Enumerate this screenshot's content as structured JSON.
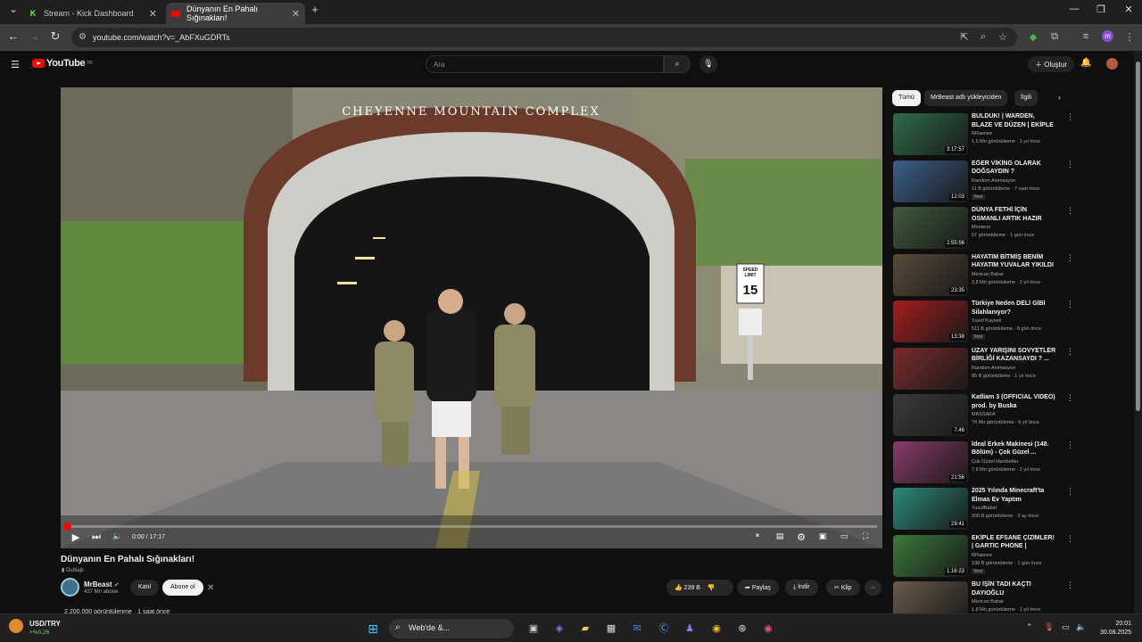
{
  "browser": {
    "tabs": [
      {
        "label": "Stream - Kick Dashboard",
        "active": false
      },
      {
        "label": "Dünyanın En Pahalı Sığınakları!",
        "active": true
      }
    ],
    "url": "youtube.com/watch?v=_AbFXuGDRTs"
  },
  "youtube": {
    "region": "TR",
    "logo": "YouTube",
    "search_placeholder": "Ara",
    "create_label": "Oluştur"
  },
  "video": {
    "scene_sign": "CHEYENNE MOUNTAIN COMPLEX",
    "speed_sign_top": "SPEED LIMIT",
    "speed_sign_value": "15",
    "time": "0:00 / 17:17",
    "progress": 0.0,
    "title": "Dünyanın En Pahalı Sığınakları!",
    "dubbed": "Dublajlı",
    "channel": "MrBeast",
    "subscribers": "427 Mn abone",
    "join_label": "Katıl",
    "subscribe_label": "Abone ol",
    "likes": "239 B",
    "share_label": "Paylaş",
    "download_label": "İndir",
    "clip_label": "Klip",
    "views_line": "2.200.000 görüntülenme · 1 saat önce"
  },
  "chips": [
    "Tümü",
    "MrBeast adlı yükleyiciden",
    "İlgili"
  ],
  "recommendations": [
    {
      "title": "BULDUK! | WARDEN, BLAZE VE DÜZEN | EKİPLE ...",
      "channel": "RRaenee",
      "stats": "1,5 Mn görüntüleme · 1 yıl önce",
      "duration": "3:17:57",
      "color": "#2f6b4a",
      "new": ""
    },
    {
      "title": "EĞER VİKİNG OLARAK DOĞSAYDIN ?",
      "channel": "Random Animasyon",
      "stats": "11 B görüntüleme · 7 saat önce",
      "duration": "12:03",
      "color": "#3a5f8a",
      "new": "Yeni"
    },
    {
      "title": "DÜNYA FETHİ İÇİN OSMANLI ARTIK HAZIR !!!!!!!(RUSYAYA ...",
      "channel": "Monteux",
      "stats": "67 görüntüleme · 1 gün önce",
      "duration": "2:55:56",
      "color": "#3d5a3a",
      "new": ""
    },
    {
      "title": "HAYATIM BİTMİŞ BENİM HAYATIM YUVALAR YIKILDI",
      "channel": "Mertcan Bahar",
      "stats": "2,8 Mn görüntüleme · 2 yıl önce",
      "duration": "23:35",
      "color": "#5a4a3a",
      "new": ""
    },
    {
      "title": "Türkiye Neden DELİ GİBİ Silahlanıyor?",
      "channel": "Yusuf Kayseli",
      "stats": "511 B görüntüleme · 8 gün önce",
      "duration": "13:38",
      "color": "#a51c1c",
      "new": "Yeni"
    },
    {
      "title": "UZAY YARIŞINI SOVYETLER BİRLİĞİ KAZANSAYDI ? ...",
      "channel": "Random Animasyon",
      "stats": "85 B görüntüleme · 1 yıl önce",
      "duration": "",
      "color": "#7a2a2a",
      "new": ""
    },
    {
      "title": "Katliam 3 (OFFICIAL VIDEO) prod. by Buska",
      "channel": "MASSAKA",
      "stats": "74 Mn görüntüleme · 6 yıl önce",
      "duration": "7:46",
      "color": "#3a3a3a",
      "new": ""
    },
    {
      "title": "İdeal Erkek Makinesi (148. Bölüm) - Çok Güzel ...",
      "channel": "Çok Güzel Hareketler",
      "stats": "7,8 Mn görüntüleme · 2 yıl önce",
      "duration": "21:56",
      "color": "#8a3a6a",
      "new": ""
    },
    {
      "title": "2025 Yılında Minecraft'ta Elmas Ev Yaptım",
      "channel": "YusufBabal",
      "stats": "300 B görüntüleme · 3 ay önce",
      "duration": "29:41",
      "color": "#2a8a7a",
      "new": ""
    },
    {
      "title": "EKİPLE EFSANE ÇİZİMLER! | GARTIC PHONE |",
      "channel": "RRaenee",
      "stats": "198 B görüntüleme · 1 gün önce",
      "duration": "1:16:23",
      "color": "#3a7a3a",
      "new": "Yeni"
    },
    {
      "title": "BU İŞİN TADI KAÇTI DAYIOĞLU",
      "channel": "Mertcan Bahar",
      "stats": "1,8 Mn görüntüleme · 1 yıl önce",
      "duration": "",
      "color": "#6a5a4a",
      "new": ""
    }
  ],
  "taskbar": {
    "ticker": "USD/TRY",
    "ticker_change": "+%0,26",
    "search_label": "Web'de &...",
    "time": "20:01",
    "date": "30.08.2025"
  },
  "colors": {
    "accent": "#ff0000",
    "background": "#0f0f0f"
  }
}
